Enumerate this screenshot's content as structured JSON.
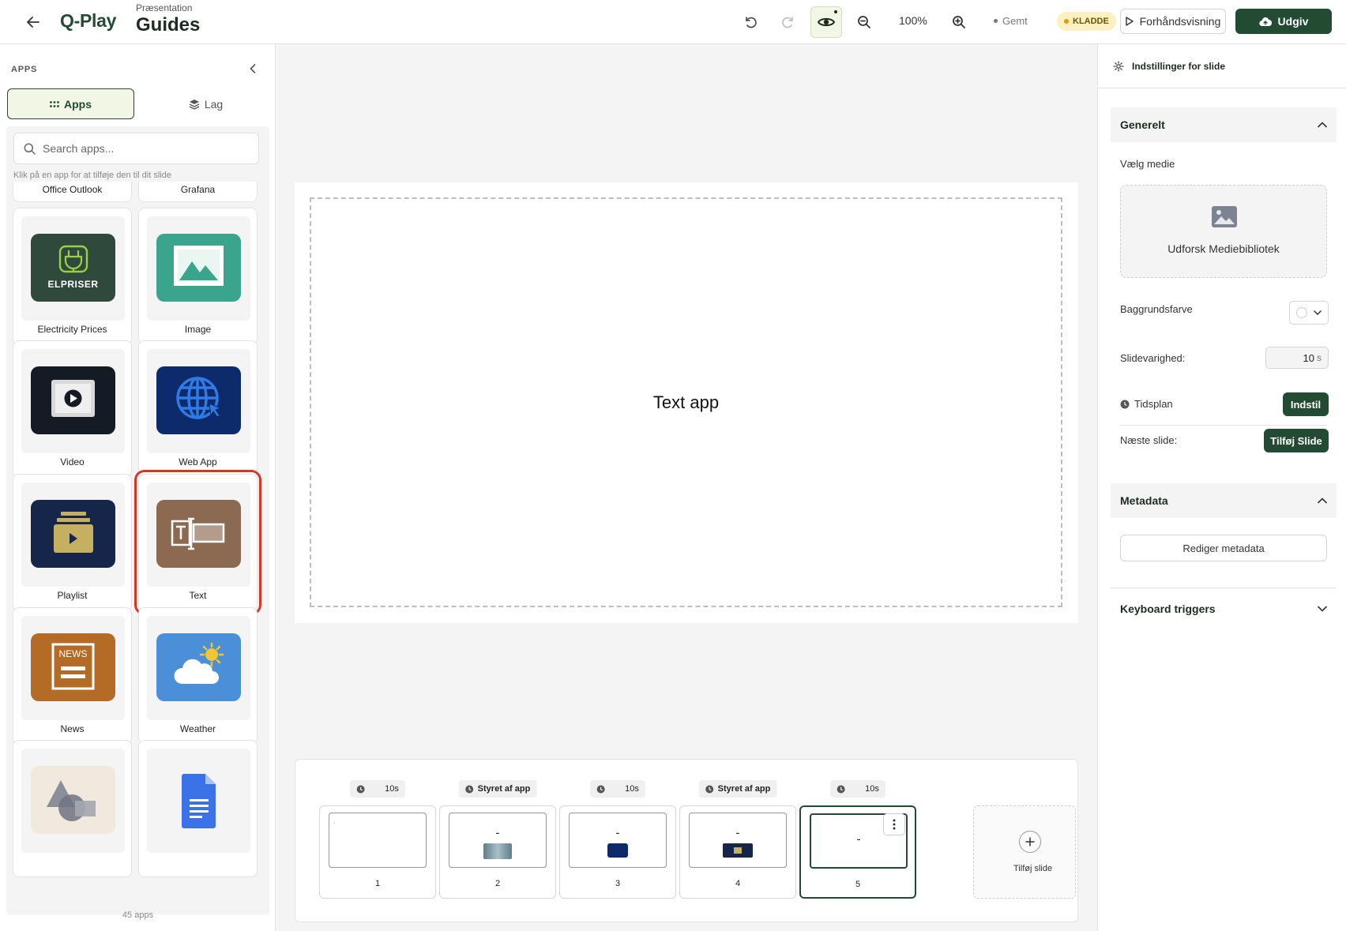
{
  "header": {
    "logo": "Q-Play",
    "kicker": "Præsentation",
    "title": "Guides",
    "zoom": "100%",
    "saved": "Gemt",
    "draft": "KLADDE",
    "preview": "Forhåndsvisning",
    "publish": "Udgiv"
  },
  "sidebar": {
    "heading": "APPS",
    "tab_apps": "Apps",
    "tab_layers": "Lag",
    "search_placeholder": "Search apps...",
    "hint": "Klik på en app for at tilføje den til dit slide",
    "apps": [
      {
        "label": "Office Outlook",
        "icon": "outlook-icon"
      },
      {
        "label": "Grafana",
        "icon": "grafana-icon"
      },
      {
        "label": "Electricity Prices",
        "icon": "electricity-prices-icon",
        "icon_text": "ELPRISER",
        "color": "#2f4a3c"
      },
      {
        "label": "Image",
        "icon": "image-icon",
        "color": "#3aa58c"
      },
      {
        "label": "Video",
        "icon": "video-icon",
        "color": "#151b24"
      },
      {
        "label": "Web App",
        "icon": "globe-icon",
        "color": "#0d2a6b"
      },
      {
        "label": "Playlist",
        "icon": "playlist-icon",
        "color": "#16254a"
      },
      {
        "label": "Text",
        "icon": "text-icon",
        "color": "#8c6a52"
      },
      {
        "label": "News",
        "icon": "news-icon",
        "icon_text": "NEWS",
        "color": "#b36b26"
      },
      {
        "label": "Weather",
        "icon": "weather-icon",
        "color": "#4a8fd8"
      },
      {
        "label": "Shapes",
        "icon": "shapes-icon",
        "color": "#f1e8de"
      },
      {
        "label": "Google Docs",
        "icon": "google-docs-icon",
        "color": "#f4f4f4"
      }
    ],
    "count": "45 apps"
  },
  "canvas": {
    "text": "Text app"
  },
  "filmstrip": {
    "slides": [
      {
        "num": "1",
        "duration": "10",
        "unit": "s",
        "mode": "timed"
      },
      {
        "num": "2",
        "duration": "Styret af app",
        "mode": "app"
      },
      {
        "num": "3",
        "duration": "10",
        "unit": "s",
        "mode": "timed"
      },
      {
        "num": "4",
        "duration": "Styret af app",
        "mode": "app"
      },
      {
        "num": "5",
        "duration": "10",
        "unit": "s",
        "mode": "timed",
        "active": true
      }
    ],
    "add_label": "Tilføj slide"
  },
  "settings": {
    "header": "Indstillinger for slide",
    "general": "Generelt",
    "choose_media": "Vælg medie",
    "explore_media": "Udforsk Mediebibliotek",
    "bg_color": "Baggrundsfarve",
    "duration_label": "Slidevarighed:",
    "duration_value": "10",
    "duration_unit": "s",
    "schedule": "Tidsplan",
    "schedule_btn": "Indstil",
    "next_slide": "Næste slide:",
    "next_slide_btn": "Tilføj Slide",
    "metadata": "Metadata",
    "edit_metadata": "Rediger metadata",
    "keyboard_triggers": "Keyboard triggers"
  },
  "colors": {
    "brand": "#234a33",
    "selection": "#d4391f",
    "draft_badge": "#fdf1c2"
  }
}
